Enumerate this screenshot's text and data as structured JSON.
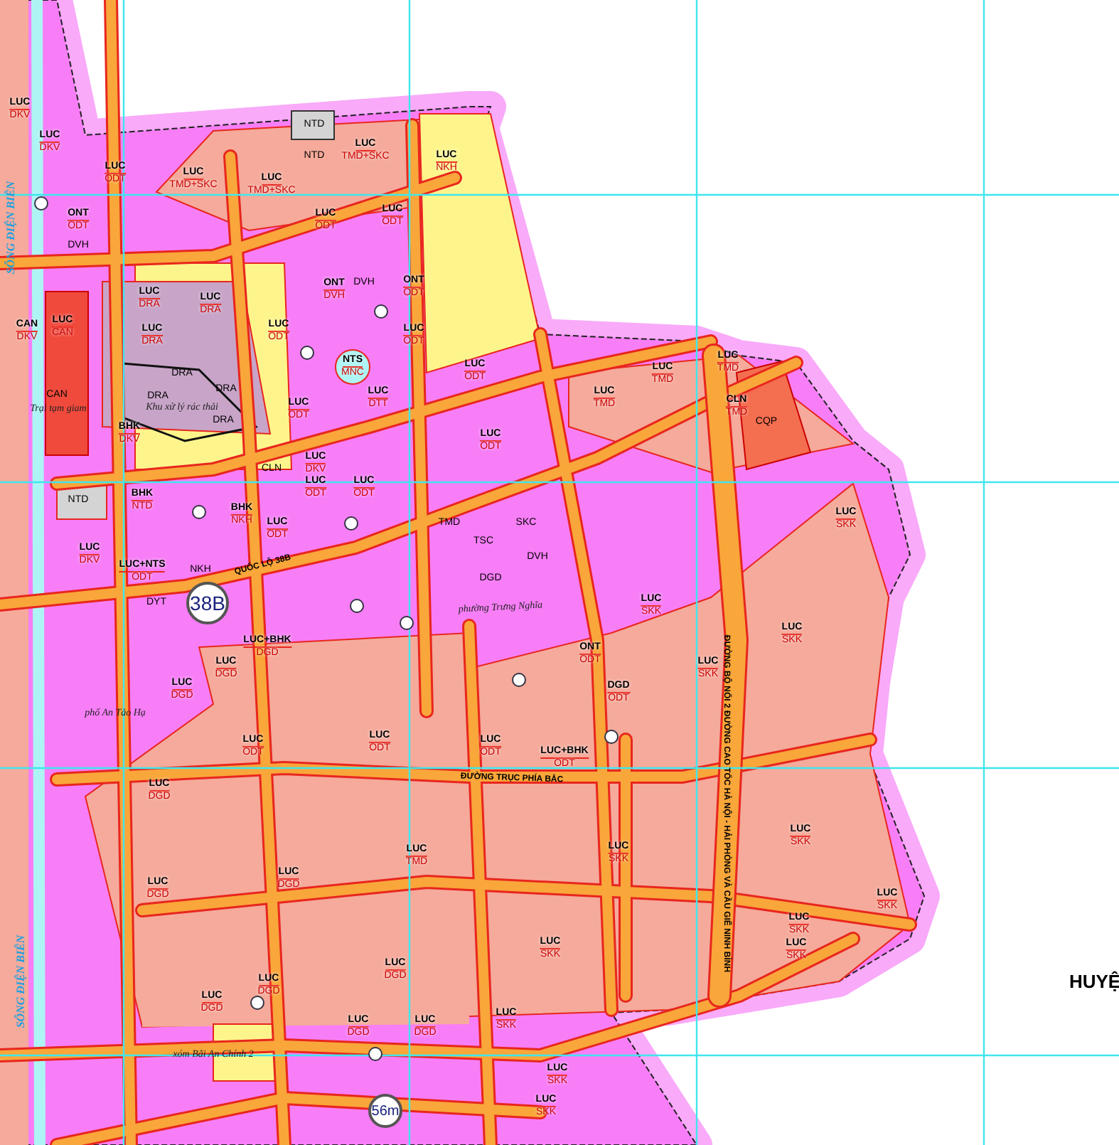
{
  "map": {
    "zones": [
      {
        "current": "LUC",
        "planned": "DKV"
      },
      {
        "current": "LUC",
        "planned": "ODT"
      },
      {
        "current": "LUC",
        "planned": "TMD+SKC"
      },
      {
        "current": "LUC",
        "planned": "TMD+SKC"
      },
      {
        "current": "LUC",
        "planned": "TMD+SKC"
      },
      {
        "current": "LUC",
        "planned": "NKH"
      },
      {
        "current": "LUC",
        "planned": "DKV"
      },
      {
        "current": "ONT",
        "planned": "ODT"
      },
      {
        "current": "LUC",
        "planned": "ODT"
      },
      {
        "current": "LUC",
        "planned": "ODT"
      },
      {
        "current": "ONT",
        "planned": "ODT"
      },
      {
        "current": "ONT",
        "planned": "DVH"
      },
      {
        "current": "CAN",
        "planned": "DKV"
      },
      {
        "current": "LUC",
        "planned": "CAN"
      },
      {
        "current": "LUC",
        "planned": "DRA"
      },
      {
        "current": "LUC",
        "planned": "DRA"
      },
      {
        "current": "LUC",
        "planned": "DRA"
      },
      {
        "current": "LUC",
        "planned": "ODT"
      },
      {
        "current": "LUC",
        "planned": "ODT"
      },
      {
        "current": "NTS",
        "planned": "MNC"
      },
      {
        "current": "LUC",
        "planned": "ODT"
      },
      {
        "current": "LUC",
        "planned": "ODT"
      },
      {
        "current": "LUC",
        "planned": "DTT"
      },
      {
        "current": "LUC",
        "planned": "ODT"
      },
      {
        "current": "BHK",
        "planned": "DKV"
      },
      {
        "current": "LUC",
        "planned": "DKV"
      },
      {
        "current": "BHK",
        "planned": "NTD"
      },
      {
        "current": "LUC",
        "planned": "ODT"
      },
      {
        "current": "LUC",
        "planned": "ODT"
      },
      {
        "current": "BHK",
        "planned": "NKH"
      },
      {
        "current": "LUC",
        "planned": "ODT"
      },
      {
        "current": "LUC",
        "planned": "TMD"
      },
      {
        "current": "LUC",
        "planned": "TMD"
      },
      {
        "current": "LUC",
        "planned": "TMD"
      },
      {
        "current": "CLN",
        "planned": "TMD"
      },
      {
        "current": "LUC",
        "planned": "SKK"
      },
      {
        "current": "LUC",
        "planned": "SKK"
      },
      {
        "current": "LUC",
        "planned": "SKK"
      },
      {
        "current": "LUC",
        "planned": "SKK"
      },
      {
        "current": "ONT",
        "planned": "ODT"
      },
      {
        "current": "DGD",
        "planned": "ODT"
      },
      {
        "current": "LUC+BHK",
        "planned": "ODT"
      },
      {
        "current": "LUC+BHK",
        "planned": "DGD"
      },
      {
        "current": "LUC",
        "planned": "DGD"
      },
      {
        "current": "LUC",
        "planned": "DGD"
      },
      {
        "current": "LUC",
        "planned": "DKV"
      },
      {
        "current": "LUC+NTS",
        "planned": "ODT"
      },
      {
        "current": "LUC",
        "planned": "ODT"
      },
      {
        "current": "LUC",
        "planned": "ODT"
      },
      {
        "current": "LUC",
        "planned": "ODT"
      },
      {
        "current": "LUC",
        "planned": "DGD"
      },
      {
        "current": "LUC",
        "planned": "DGD"
      },
      {
        "current": "LUC",
        "planned": "DGD"
      },
      {
        "current": "LUC",
        "planned": "TMD"
      },
      {
        "current": "LUC",
        "planned": "SKK"
      },
      {
        "current": "LUC",
        "planned": "DGD"
      },
      {
        "current": "LUC",
        "planned": "DGD"
      },
      {
        "current": "LUC",
        "planned": "DGD"
      },
      {
        "current": "LUC",
        "planned": "DGD"
      },
      {
        "current": "LUC",
        "planned": "DGD"
      },
      {
        "current": "LUC",
        "planned": "SKK"
      },
      {
        "current": "LUC",
        "planned": "SKK"
      },
      {
        "current": "LUC",
        "planned": "SKK"
      },
      {
        "current": "LUC",
        "planned": "SKK"
      },
      {
        "current": "LUC",
        "planned": "SKK"
      },
      {
        "current": "LUC",
        "planned": "SKK"
      },
      {
        "current": "LUC",
        "planned": "SKK"
      },
      {
        "current": "LUC",
        "planned": "SKK"
      }
    ],
    "codes": [
      "CQP",
      "DRA",
      "DRA",
      "DRA",
      "DRA",
      "CAN",
      "NTD",
      "NTD",
      "NTD",
      "DVH",
      "CLN",
      "NKH",
      "DYT",
      "TMD",
      "DVH",
      "TSC",
      "SKC",
      "DGD",
      "DVH"
    ],
    "roads": [
      {
        "name": "ĐƯỜNG TRỤC PHÍA BẮC"
      },
      {
        "name": "ĐƯỜNG BỘ NỐI 2 ĐƯỜNG CAO TỐC HÀ NỘI - HẢI PHÒNG VÀ CẦU GIẼ NINH BÌNH"
      },
      {
        "name": "QUỐC LỘ 38B"
      }
    ],
    "rivers": [
      "SÔNG ĐIỆN BIÊN",
      "SÔNG ĐIỆN BIÊN"
    ],
    "places": [
      "phường Trưng Nghĩa",
      "phố An Tảo Hạ",
      "xóm Bãi An Chính 2",
      "Trại tạm giam",
      "Khu xử lý rác thải"
    ],
    "route_badges": [
      "38B",
      "56m"
    ],
    "region_label": "HUYỆ"
  }
}
